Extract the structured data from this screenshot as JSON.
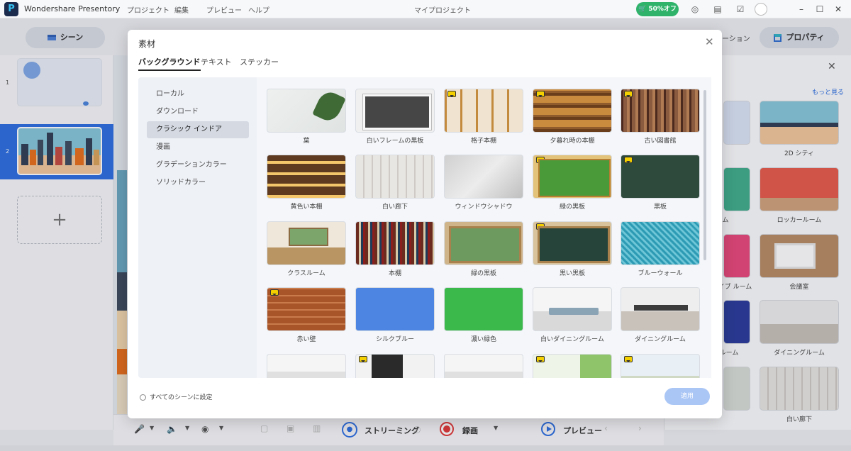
{
  "app": {
    "name": "Wondershare Presentory",
    "project_title": "マイプロジェクト"
  },
  "menu": [
    "プロジェクト",
    "編集",
    "プレビュー",
    "ヘルプ"
  ],
  "titlebar": {
    "sale_badge": "50%オフ"
  },
  "left": {
    "scene_button": "シーン",
    "scenes": [
      {
        "num": "1"
      },
      {
        "num": "2"
      }
    ],
    "add_scene": "+"
  },
  "right": {
    "properties_button": "プロパティ",
    "partial_tab": "ーション",
    "more": "もっと見る",
    "items": [
      {
        "label": "2D シティ"
      },
      {
        "label": "ロッカールーム"
      },
      {
        "label": "会議室"
      },
      {
        "label": "ダイニングルーム"
      },
      {
        "label": "白い廊下"
      }
    ],
    "partial_labels": [
      "ム",
      "ライブ ルーム",
      "ルーム"
    ]
  },
  "modal": {
    "title": "素材",
    "tabs": [
      "バックグラウンド",
      "テキスト",
      "ステッカー"
    ],
    "active_tab": "バックグラウンド",
    "categories": [
      "ローカル",
      "ダウンロード",
      "クラシック インドア",
      "漫画",
      "グラデーションカラー",
      "ソリッドカラー"
    ],
    "selected_category": "クラシック インドア",
    "items": [
      {
        "label": "葉",
        "premium": false
      },
      {
        "label": "白いフレームの黒板",
        "premium": false
      },
      {
        "label": "格子本棚",
        "premium": true
      },
      {
        "label": "夕暮れ時の本棚",
        "premium": true
      },
      {
        "label": "古い図書館",
        "premium": true
      },
      {
        "label": "黄色い本棚",
        "premium": false
      },
      {
        "label": "白い廊下",
        "premium": false
      },
      {
        "label": "ウィンドウシャドウ",
        "premium": false
      },
      {
        "label": "緑の黒板",
        "premium": true
      },
      {
        "label": "黒板",
        "premium": true
      },
      {
        "label": "クラスルーム",
        "premium": false
      },
      {
        "label": "本棚",
        "premium": false
      },
      {
        "label": "緑の黒板",
        "premium": false
      },
      {
        "label": "黒い黒板",
        "premium": true
      },
      {
        "label": "ブルーウォール",
        "premium": false
      },
      {
        "label": "赤い壁",
        "premium": true
      },
      {
        "label": "シルクブルー",
        "premium": false
      },
      {
        "label": "濃い緑色",
        "premium": false
      },
      {
        "label": "白いダイニングルーム",
        "premium": false
      },
      {
        "label": "ダイニングルーム",
        "premium": false
      }
    ],
    "apply_all_label": "すべてのシーンに設定",
    "apply_button": "適用"
  },
  "bottombar": {
    "streaming": "ストリーミング",
    "record": "録画",
    "preview": "プレビュー"
  },
  "colors": {
    "accent": "#2d6fe2",
    "sale": "#2fb36b",
    "record": "#e23a3a",
    "premium": "#f5d000"
  }
}
